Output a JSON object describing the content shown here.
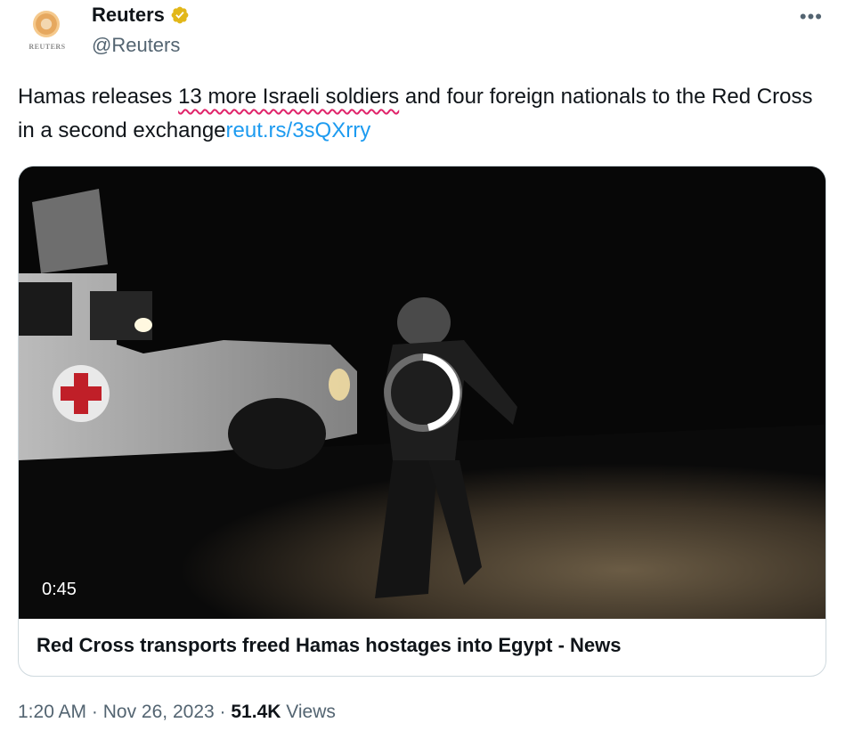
{
  "author": {
    "display_name": "Reuters",
    "handle": "@Reuters",
    "avatar_label": "REUTERS"
  },
  "tweet": {
    "text_before": "Hamas releases ",
    "text_underlined": "13 more Israeli soldiers",
    "text_after": " and four foreign nationals to the Red Cross in a second exchange",
    "link": "reut.rs/3sQXrry"
  },
  "card": {
    "duration": "0:45",
    "title": "Red Cross transports freed Hamas hostages into Egypt - News"
  },
  "meta": {
    "time": "1:20 AM",
    "separator": "·",
    "date": "Nov 26, 2023",
    "views_count": "51.4K",
    "views_label": "Views"
  },
  "icons": {
    "verified": "verified-badge-icon",
    "more": "more-options-icon",
    "loading": "loading-spinner-icon"
  },
  "colors": {
    "link": "#1d9bf0",
    "secondary_text": "#536471",
    "verified_gold": "#e2b719",
    "spellcheck_underline": "#e0246a"
  }
}
